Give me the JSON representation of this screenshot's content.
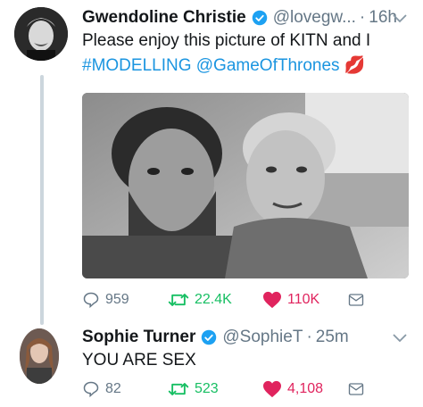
{
  "tweets": [
    {
      "name": "Gwendoline Christie",
      "handle": "@lovegw...",
      "separator": "·",
      "time": "16h",
      "text_prefix": "Please enjoy this picture of KITN and I",
      "hashtag": "#MODELLING",
      "mention": "@GameOfThrones",
      "emoji": "💋",
      "replies": "959",
      "retweets": "22.4K",
      "likes": "110K"
    },
    {
      "name": "Sophie Turner",
      "handle": "@SophieT",
      "separator": "·",
      "time": "25m",
      "text": "YOU ARE SEX",
      "replies": "82",
      "retweets": "523",
      "likes": "4,108"
    }
  ],
  "colors": {
    "link": "#1b95e0",
    "retweet": "#17bf63",
    "like": "#e0245e",
    "muted": "#657786",
    "verified": "#1da1f2"
  },
  "icons": [
    "verified-badge-icon",
    "chevron-down-icon",
    "reply-icon",
    "retweet-icon",
    "heart-icon",
    "direct-message-icon"
  ]
}
